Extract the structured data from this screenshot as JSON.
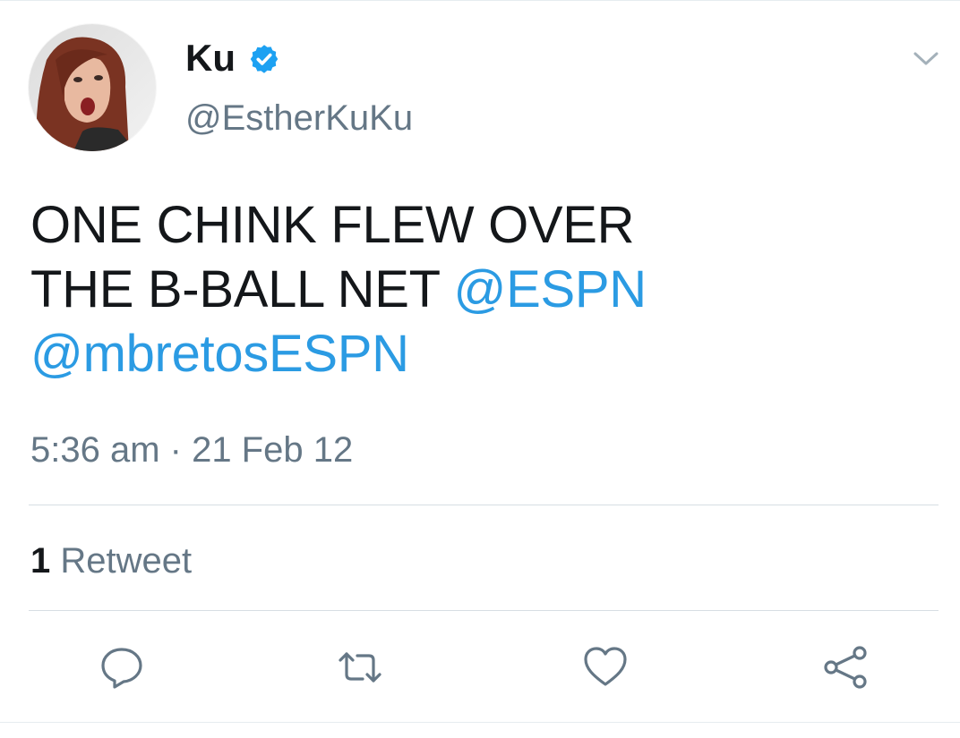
{
  "user": {
    "display_name": "Ku",
    "handle": "@EstherKuKu",
    "verified": true,
    "avatar_icon": "avatar"
  },
  "tweet": {
    "line1": "ONE CHINK FLEW OVER",
    "line2_text": "THE B-BALL NET ",
    "mention1": "@ESPN",
    "mention2": "@mbretosESPN",
    "timestamp": "5:36 am · 21 Feb 12"
  },
  "stats": {
    "retweet_count": "1",
    "retweet_label": "Retweet"
  },
  "actions": [
    "reply-icon",
    "retweet-icon",
    "like-icon",
    "share-icon"
  ],
  "colors": {
    "text": "#14171a",
    "secondary": "#657786",
    "link": "#2b9be3",
    "verified": "#1da1f2",
    "divider": "#d7dee3"
  }
}
